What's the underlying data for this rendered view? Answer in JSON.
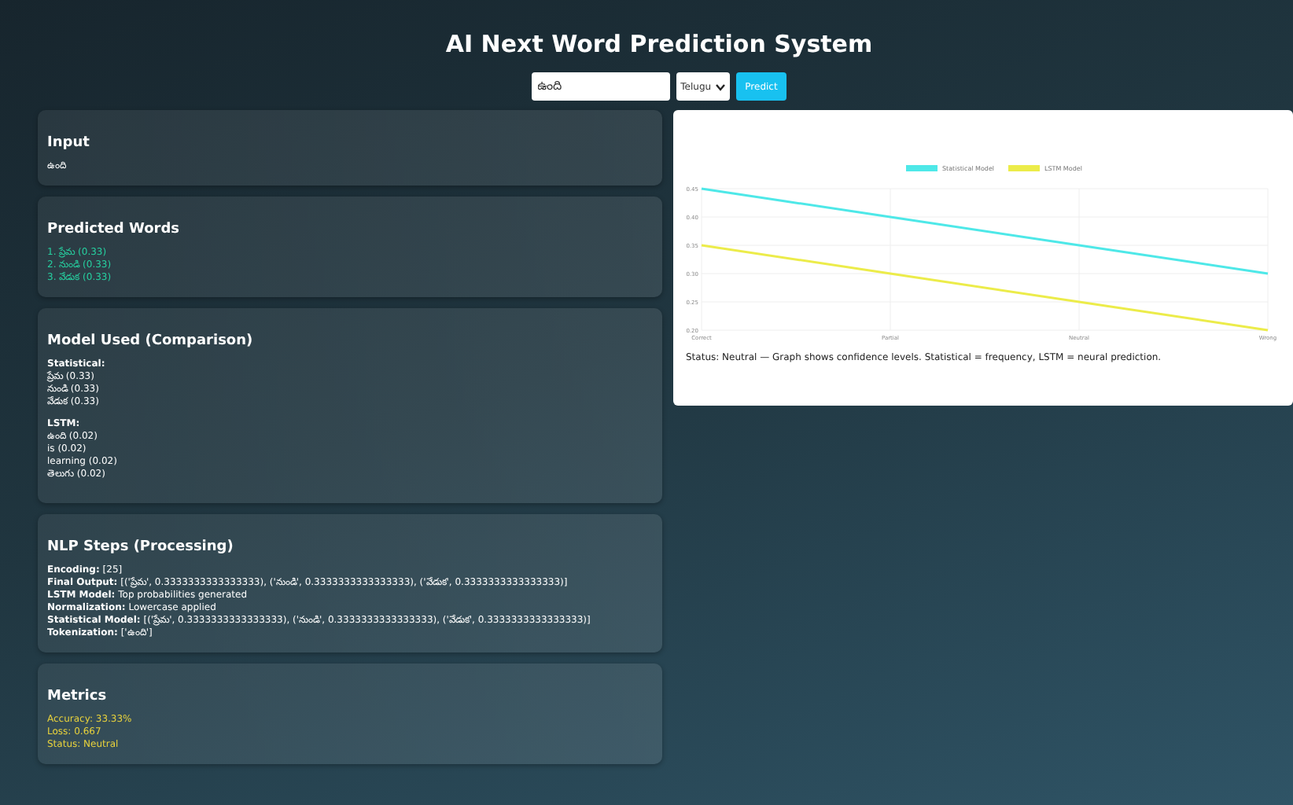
{
  "title": "AI Next Word Prediction System",
  "controls": {
    "input_value": "ఉంది",
    "language": "Telugu",
    "button": "Predict"
  },
  "cards": [
    {
      "kind": "plain",
      "title": "Input",
      "lines": [
        "ఉంది"
      ]
    },
    {
      "kind": "predictions",
      "title": "Predicted Words",
      "lines": [
        "1. ప్రేమ (0.33)",
        "2. నుండి (0.33)",
        "3. వేడుక (0.33)"
      ]
    },
    {
      "kind": "groups",
      "title": "Model Used (Comparison)",
      "groups": [
        {
          "label": "Statistical:",
          "lines": [
            "ప్రేమ (0.33)",
            "నుండి (0.33)",
            "వేడుక (0.33)"
          ]
        },
        {
          "label": "LSTM:",
          "lines": [
            "ఉంది (0.02)",
            "is (0.02)",
            "learning (0.02)",
            "తెలుగు (0.02)"
          ]
        }
      ]
    },
    {
      "kind": "steps",
      "title": "NLP Steps (Processing)",
      "steps": [
        {
          "label": "Encoding:",
          "value": "[25]"
        },
        {
          "label": "Final Output:",
          "value": "[('ప్రేమ', 0.3333333333333333), ('నుండి', 0.3333333333333333), ('వేడుక', 0.3333333333333333)]"
        },
        {
          "label": "LSTM Model:",
          "value": "Top probabilities generated"
        },
        {
          "label": "Normalization:",
          "value": "Lowercase applied"
        },
        {
          "label": "Statistical Model:",
          "value": "[('ప్రేమ', 0.3333333333333333), ('నుండి', 0.3333333333333333), ('వేడుక', 0.3333333333333333)]"
        },
        {
          "label": "Tokenization:",
          "value": "['ఉంది']"
        }
      ]
    },
    {
      "kind": "metrics",
      "title": "Metrics",
      "lines": [
        "Accuracy: 33.33%",
        "Loss: 0.667",
        "Status: Neutral"
      ]
    }
  ],
  "chart_panel": {
    "caption": "Status: Neutral — Graph shows confidence levels. Statistical = frequency, LSTM = neural prediction.",
    "chart_data": {
      "type": "line",
      "categories": [
        "Correct",
        "Partial",
        "Neutral",
        "Wrong"
      ],
      "ylim": [
        0.2,
        0.45
      ],
      "yticks": [
        {
          "value": 0.2,
          "label": "0.20"
        },
        {
          "value": 0.25,
          "label": "0.25"
        },
        {
          "value": 0.3,
          "label": "0.30"
        },
        {
          "value": 0.35,
          "label": "0.35"
        },
        {
          "value": 0.4,
          "label": "0.40"
        },
        {
          "value": 0.45,
          "label": "0.45"
        }
      ],
      "grid": true,
      "legend": true,
      "series": [
        {
          "name": "Statistical Model",
          "color": "#4ee8e8",
          "values": [
            0.45,
            0.4,
            0.35,
            0.3
          ]
        },
        {
          "name": "LSTM Model",
          "color": "#ecec4a",
          "values": [
            0.35,
            0.3,
            0.25,
            0.2
          ]
        }
      ]
    }
  }
}
